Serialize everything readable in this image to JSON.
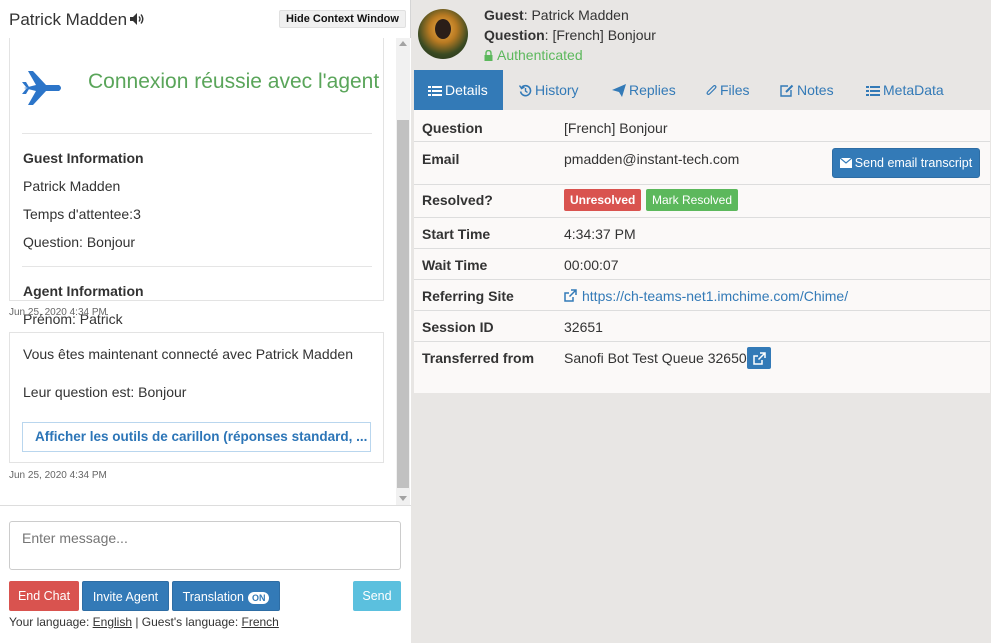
{
  "left": {
    "guest_name": "Patrick Madden",
    "hide_context_label": "Hide Context Window",
    "card1": {
      "title": "Connexion réussie avec l'agent",
      "guest_info_header": "Guest Information",
      "guest_name": "Patrick Madden",
      "wait": "Temps d'attentee:3",
      "question": "Question: Bonjour",
      "agent_info_header": "Agent Information",
      "agent_first_name": "Prénom: Patrick"
    },
    "timestamp1": "Jun 25, 2020 4:34 PM",
    "card2": {
      "line1": "Vous êtes maintenant connecté avec Patrick Madden",
      "line2": "Leur question est: Bonjour",
      "link": "Afficher les outils de carillon (réponses standard, ..."
    },
    "timestamp2": "Jun 25, 2020 4:34 PM",
    "compose": {
      "placeholder": "Enter message...",
      "end_chat": "End Chat",
      "invite_agent": "Invite Agent",
      "translation": "Translation",
      "translation_state": "ON",
      "send": "Send",
      "your_language_label": "Your language: ",
      "your_language": "English",
      "separator": " | ",
      "guest_language_label": "Guest's language: ",
      "guest_language": "French"
    }
  },
  "right": {
    "header": {
      "guest_label": "Guest",
      "guest_value": ": Patrick Madden",
      "question_label": "Question",
      "question_value": ": [French]  Bonjour",
      "auth_status": "Authenticated"
    },
    "tabs": [
      {
        "label": "Details",
        "icon": "list-icon"
      },
      {
        "label": "History",
        "icon": "history-icon"
      },
      {
        "label": "Replies",
        "icon": "send-icon"
      },
      {
        "label": "Files",
        "icon": "paperclip-icon"
      },
      {
        "label": "Notes",
        "icon": "edit-icon"
      },
      {
        "label": "MetaData",
        "icon": "list-icon"
      }
    ],
    "details": {
      "question_label": "Question",
      "question_value": "[French] Bonjour",
      "email_label": "Email",
      "email_value": "pmadden@instant-tech.com",
      "send_transcript": "Send email transcript",
      "resolved_label": "Resolved?",
      "unresolved_badge": "Unresolved",
      "mark_resolved": "Mark Resolved",
      "start_time_label": "Start Time",
      "start_time_value": "4:34:37 PM",
      "wait_time_label": "Wait Time",
      "wait_time_value": "00:00:07",
      "referring_site_label": "Referring Site",
      "referring_site_value": "https://ch-teams-net1.imchime.com/Chime/",
      "session_id_label": "Session ID",
      "session_id_value": "32651",
      "transferred_label": "Transferred from",
      "transferred_value": "Sanofi Bot Test Queue 32650"
    }
  },
  "colors": {
    "primary": "#337ab7",
    "danger": "#d9534f",
    "success": "#5cb85c",
    "info": "#5bc0de"
  }
}
